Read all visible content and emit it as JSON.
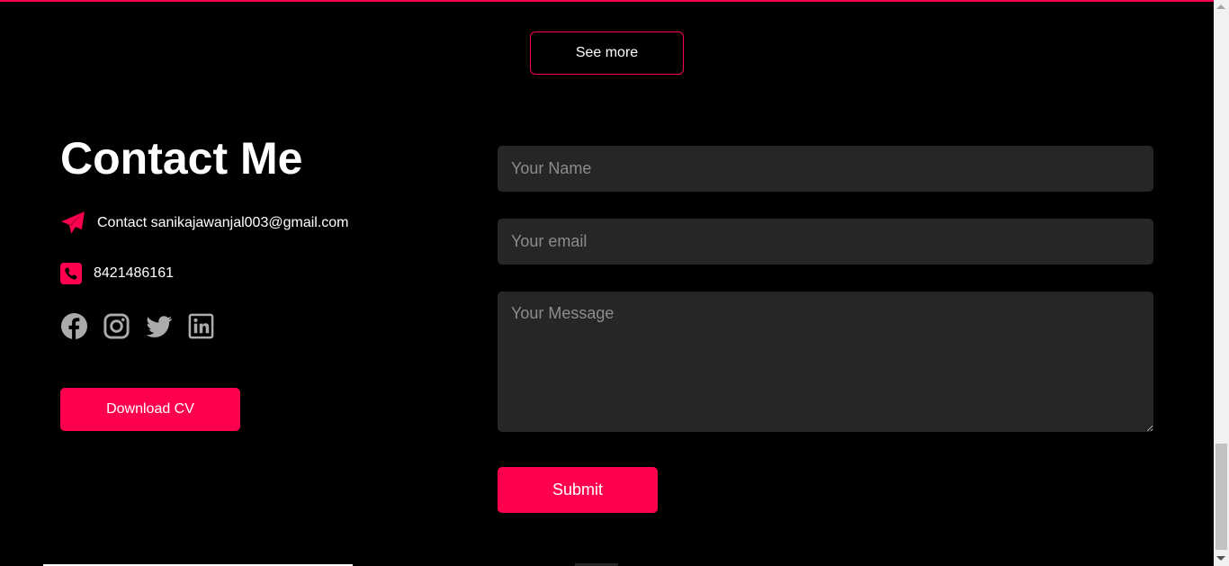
{
  "projects": {
    "see_more_label": "See more"
  },
  "contact": {
    "title": "Contact Me",
    "email_text": "Contact sanikajawanjal003@gmail.com",
    "phone_text": "8421486161",
    "download_cv_label": "Download CV",
    "social_icons": [
      "facebook-icon",
      "instagram-icon",
      "twitter-icon",
      "linkedin-icon"
    ],
    "email_icon": "paper-plane-icon",
    "phone_icon": "phone-icon"
  },
  "form": {
    "name_placeholder": "Your Name",
    "email_placeholder": "Your email",
    "message_placeholder": "Your Message",
    "submit_label": "Submit"
  },
  "colors": {
    "accent": "#ff004f",
    "background": "#000000",
    "field_bg": "#262626",
    "social_icon": "#ababab"
  }
}
